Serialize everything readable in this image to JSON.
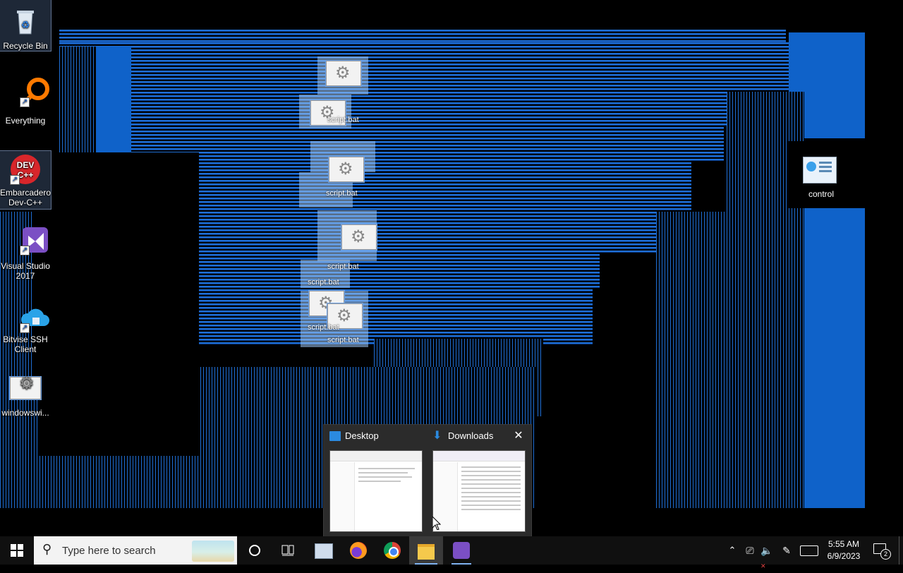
{
  "desktop": {
    "icons": [
      {
        "label": "Recycle Bin"
      },
      {
        "label": "Everything"
      },
      {
        "label": "Embarcadero Dev-C++"
      },
      {
        "label": "Visual Studio 2017"
      },
      {
        "label": "Bitvise SSH Client"
      },
      {
        "label": "windowswi..."
      },
      {
        "label": "control"
      }
    ],
    "script_label": "script.bat"
  },
  "thumbnails": {
    "items": [
      {
        "title": "Desktop"
      },
      {
        "title": "Downloads"
      }
    ],
    "close_glyph": "✕"
  },
  "taskbar": {
    "search_placeholder": "Type here to search",
    "apps": [
      "Windows Explorer (control panel)",
      "Firefox",
      "Chrome",
      "File Explorer",
      "Visual Studio"
    ],
    "clock": {
      "time": "5:55 AM",
      "date": "6/9/2023"
    },
    "notification_count": "2"
  },
  "colors": {
    "accent": "#1f6fd6",
    "taskbar": "#101010"
  }
}
